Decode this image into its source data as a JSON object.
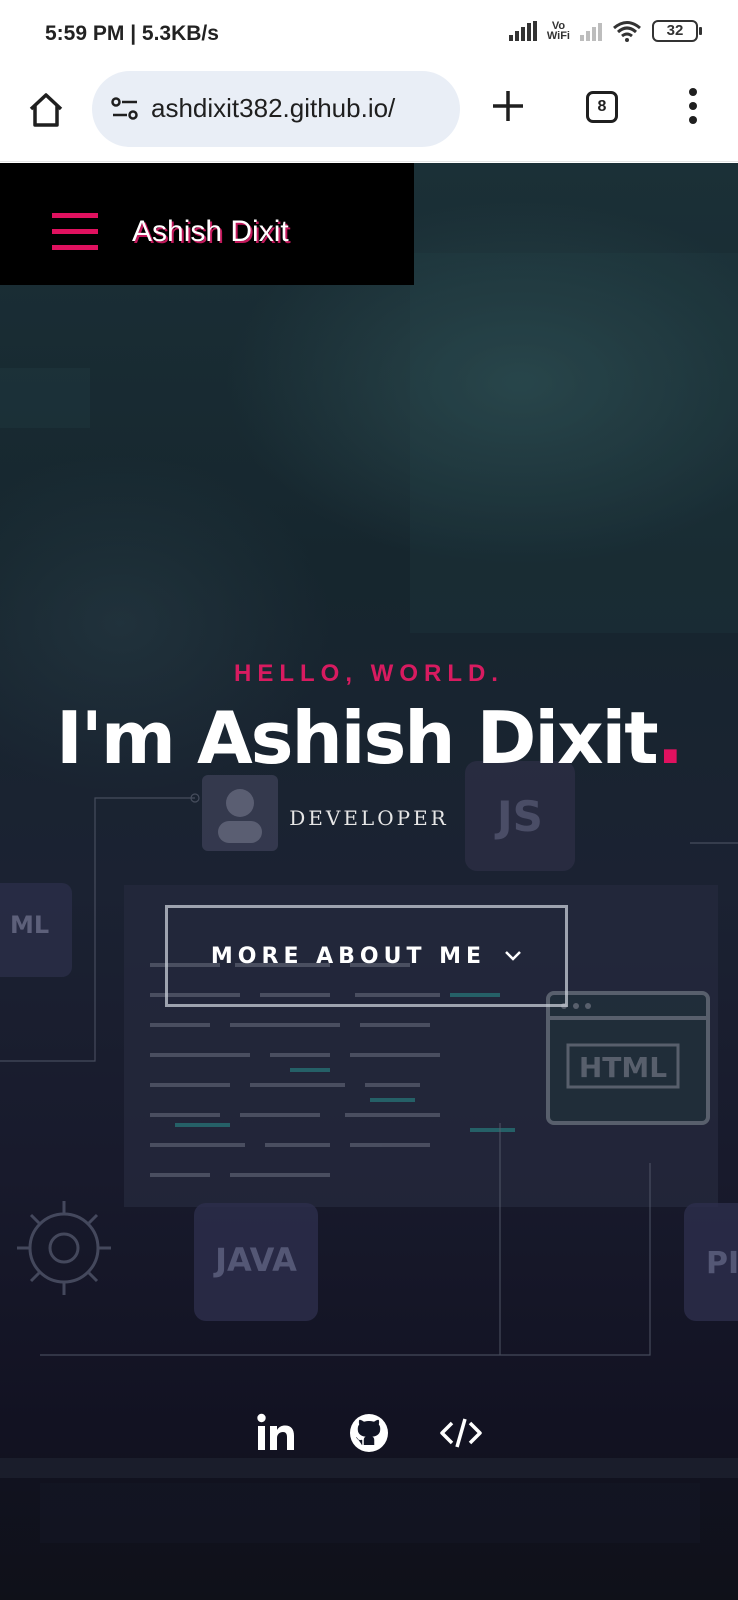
{
  "status_bar": {
    "time": "5:59 PM | 5.3KB/s",
    "vowifi_line1": "Vo",
    "vowifi_line2": "WiFi",
    "battery": "32"
  },
  "browser": {
    "url": "ashdixit382.github.io/",
    "tab_count": "8",
    "icons": [
      "home-icon",
      "site-settings-icon",
      "new-tab-icon",
      "tab-switcher-icon",
      "menu-icon"
    ]
  },
  "nav": {
    "brand": "Ashish Dixit"
  },
  "hero": {
    "greeting": "HELLO, WORLD.",
    "headline": "I'm Ashish Dixit",
    "headline_dot": ".",
    "role": "DEVELOPER",
    "cta_label": "MORE ABOUT ME",
    "background_tags": [
      "JS",
      "JAVA",
      "HTML",
      "ML",
      "PI"
    ]
  },
  "social": {
    "links": [
      "linkedin-icon",
      "github-icon",
      "code-icon"
    ]
  },
  "colors": {
    "accent": "#e0115f",
    "nav_bg": "#000000",
    "hero_bg": "#16262e"
  }
}
